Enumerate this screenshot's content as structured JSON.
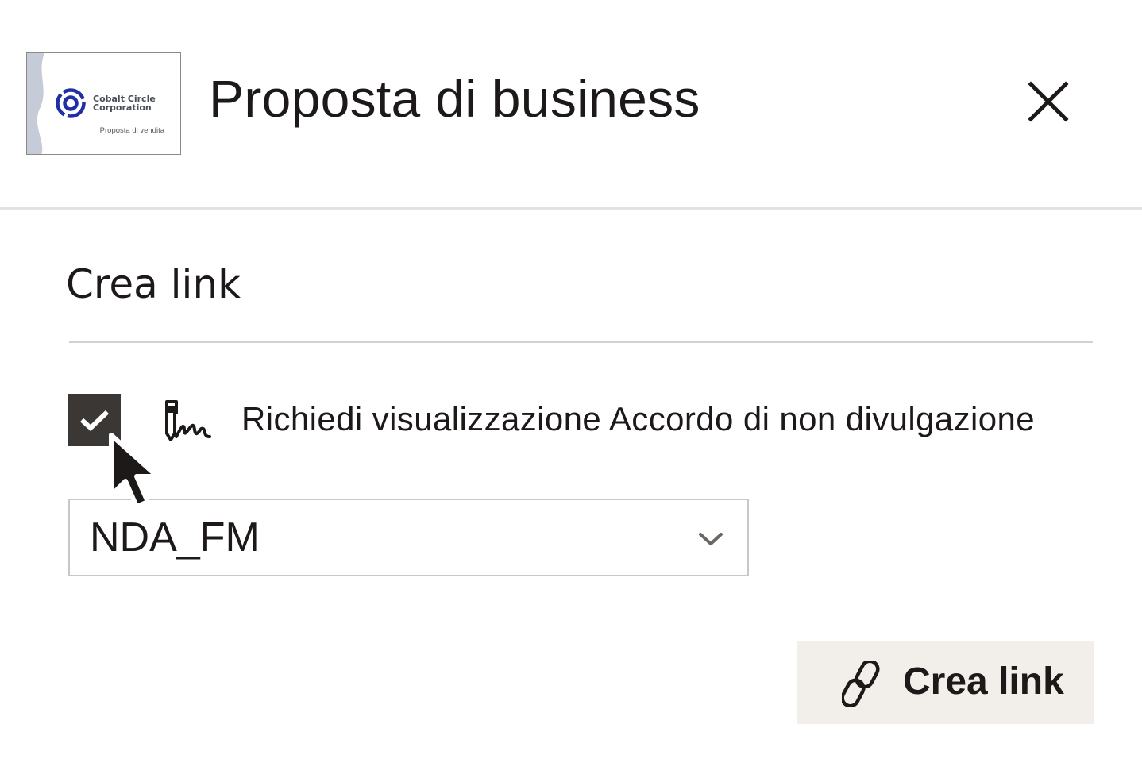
{
  "header": {
    "title": "Proposta di business",
    "thumbnail": {
      "logo_line1": "Cobalt Circle",
      "logo_line2": "Corporation",
      "caption": "Proposta di vendita",
      "logo_color": "#1f2fa6"
    },
    "close_icon": "close-icon"
  },
  "section": {
    "title": "Crea link"
  },
  "nda_option": {
    "checked": true,
    "label": "Richiedi visualizzazione Accordo di non divulgazione",
    "icon": "signature-icon"
  },
  "nda_select": {
    "value": "NDA_FM",
    "icon": "chevron-down-icon"
  },
  "actions": {
    "create_label": "Crea link",
    "create_icon": "link-icon"
  }
}
